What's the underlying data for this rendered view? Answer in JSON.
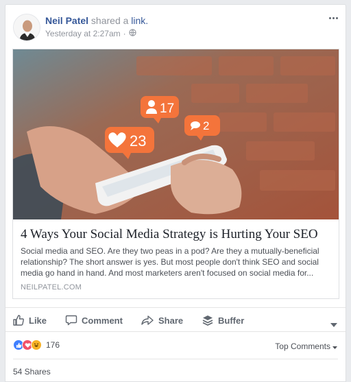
{
  "post": {
    "author": "Neil Patel",
    "action_text": "shared a",
    "action_link": "link.",
    "timestamp": "Yesterday at 2:27am",
    "separator": "·",
    "privacy_icon": "public-globe-icon"
  },
  "preview": {
    "image_badges": {
      "followers": "17",
      "comments": "2",
      "likes": "23"
    },
    "title": "4 Ways Your Social Media Strategy is Hurting Your SEO",
    "description": "Social media and SEO. Are they two peas in a pod? Are they a mutually-beneficial relationship? The short answer is yes. But most people don't think SEO and social media go hand in hand. And most marketers aren't focused on social media for...",
    "domain": "NEILPATEL.COM"
  },
  "actions": {
    "like": "Like",
    "comment": "Comment",
    "share": "Share",
    "buffer": "Buffer"
  },
  "engagement": {
    "reaction_count": "176",
    "reactions": [
      "like",
      "love",
      "haha"
    ],
    "sort_label": "Top Comments",
    "shares": "54 Shares"
  },
  "colors": {
    "link_blue": "#365899",
    "secondary_text": "#90949c",
    "action_text": "#606770",
    "badge_orange": "#f4743b",
    "like_blue": "#4080ff",
    "love_red": "#f25268",
    "haha_yellow": "#f7b125"
  }
}
